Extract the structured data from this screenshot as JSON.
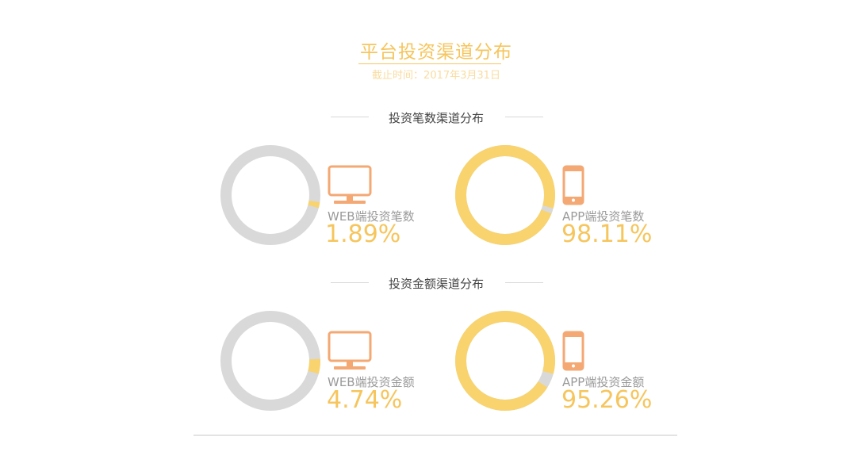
{
  "header": {
    "title": "平台投资渠道分布",
    "subtitle": "截止时间：2017年3月31日"
  },
  "colors": {
    "accent": "#f6c55c",
    "ring_gray": "#d9d9d9",
    "ring_yellow": "#f8d36e",
    "icon_orange": "#f4a873"
  },
  "chart_data": [
    {
      "type": "pie",
      "title": "投资笔数渠道分布",
      "slices": [
        {
          "label": "WEB端投资笔数",
          "value": 1.89,
          "display": "1.89%",
          "icon": "monitor-icon",
          "highlight": "#f8d36e"
        },
        {
          "label": "APP端投资笔数",
          "value": 98.11,
          "display": "98.11%",
          "icon": "phone-icon",
          "highlight": "#f8d36e"
        }
      ]
    },
    {
      "type": "pie",
      "title": "投资金额渠道分布",
      "slices": [
        {
          "label": "WEB端投资金额",
          "value": 4.74,
          "display": "4.74%",
          "icon": "monitor-icon",
          "highlight": "#f8d36e"
        },
        {
          "label": "APP端投资金额",
          "value": 95.26,
          "display": "95.26%",
          "icon": "phone-icon",
          "highlight": "#f8d36e"
        }
      ]
    }
  ]
}
